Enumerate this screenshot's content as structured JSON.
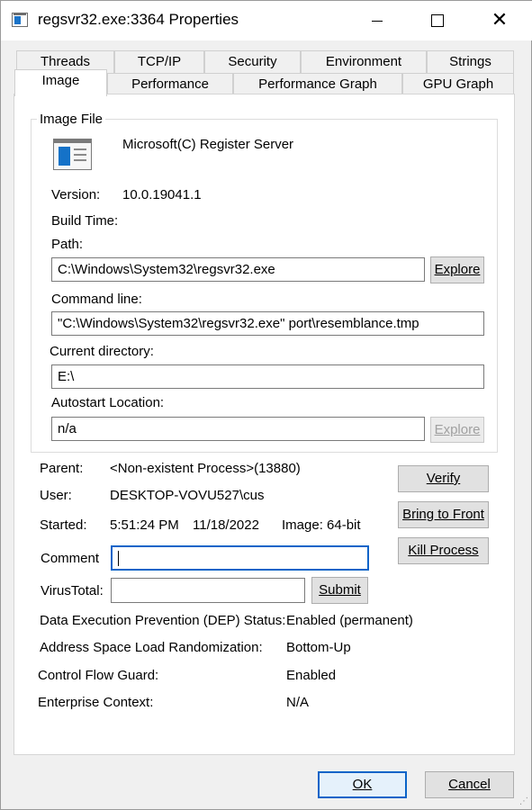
{
  "window": {
    "title": "regsvr32.exe:3364 Properties",
    "close_glyph": "✕"
  },
  "tabs": {
    "row1": [
      "Threads",
      "TCP/IP",
      "Security",
      "Environment",
      "Strings"
    ],
    "row2": [
      "Image",
      "Performance",
      "Performance Graph",
      "GPU Graph"
    ],
    "active": "Image"
  },
  "image_file": {
    "group_label": "Image File",
    "icon": "exe-window-icon",
    "description": "Microsoft(C) Register Server",
    "version_label": "Version:",
    "version_value": "10.0.19041.1",
    "build_time_label": "Build Time:",
    "build_time_value": "",
    "path_label": "Path:",
    "path_value": "C:\\Windows\\System32\\regsvr32.exe",
    "explore_label": "Explore",
    "command_line_label": "Command line:",
    "command_line_value": "\"C:\\Windows\\System32\\regsvr32.exe\" port\\resemblance.tmp",
    "current_directory_label": "Current directory:",
    "current_directory_value": "E:\\",
    "autostart_label": "Autostart Location:",
    "autostart_value": "n/a",
    "autostart_explore_label": "Explore"
  },
  "process": {
    "parent_label": "Parent:",
    "parent_value": "<Non-existent Process>(13880)",
    "user_label": "User:",
    "user_value": "DESKTOP-VOVU527\\cus",
    "started_label": "Started:",
    "started_time": "5:51:24 PM",
    "started_date": "11/18/2022",
    "image_bits": "Image: 64-bit",
    "comment_label": "Comment",
    "comment_value": "",
    "virustotal_label": "VirusTotal:",
    "virustotal_value": "",
    "submit_label": "Submit"
  },
  "actions": {
    "verify_label": "Verify",
    "bring_to_front_label": "Bring to Front",
    "kill_process_label": "Kill Process"
  },
  "security_info": {
    "dep_label": "Data Execution Prevention (DEP) Status:",
    "dep_value": "Enabled (permanent)",
    "aslr_label": "Address Space Load Randomization:",
    "aslr_value": "Bottom-Up",
    "cfg_label": "Control Flow Guard:",
    "cfg_value": "Enabled",
    "enterprise_label": "Enterprise Context:",
    "enterprise_value": "N/A"
  },
  "footer": {
    "ok_label": "OK",
    "cancel_label": "Cancel"
  }
}
